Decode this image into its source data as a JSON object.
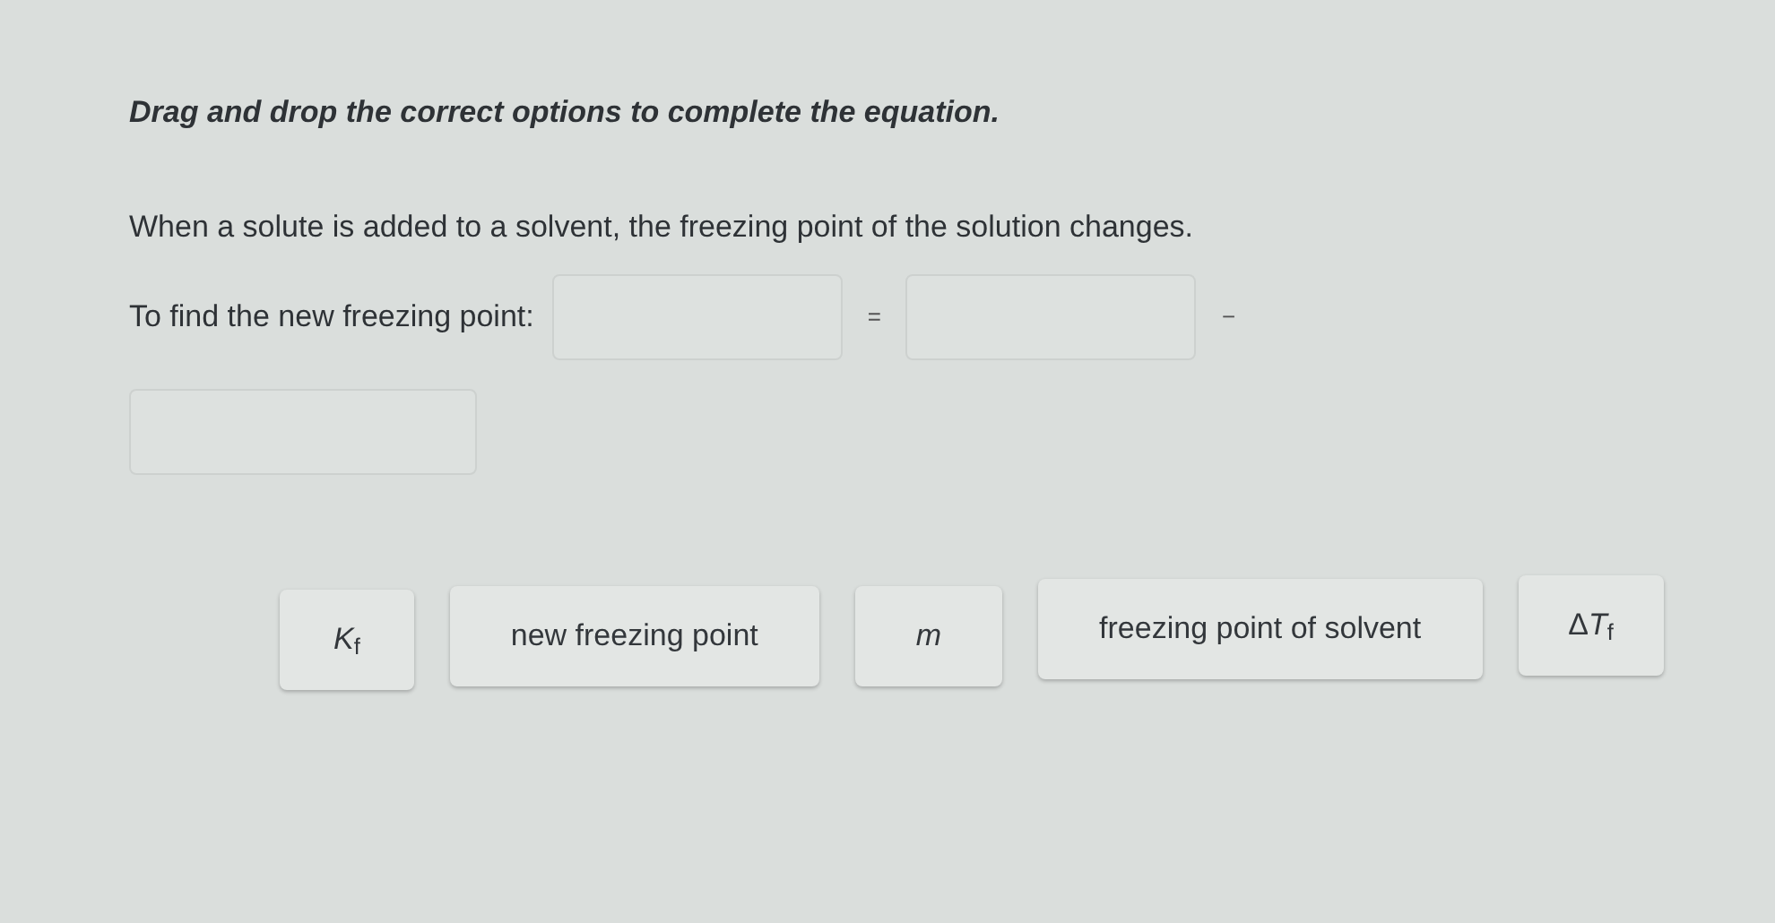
{
  "instruction": "Drag and drop the correct options to complete the equation.",
  "prompt": "When a solute is added to a solvent, the freezing point of the solution changes.",
  "equation": {
    "label": "To find the new freezing point:",
    "operators": [
      "=",
      "−"
    ],
    "slots": [
      {
        "kind": "drop"
      },
      {
        "kind": "drop"
      },
      {
        "kind": "drop"
      }
    ]
  },
  "options": [
    {
      "label": "*K*$_{f}$"
    },
    {
      "label": "new freezing point"
    },
    {
      "label": "*m*"
    },
    {
      "label": "freezing point of solvent"
    },
    {
      "prefix": "Δ",
      "label": "*T*$_{f}$"
    }
  ]
}
